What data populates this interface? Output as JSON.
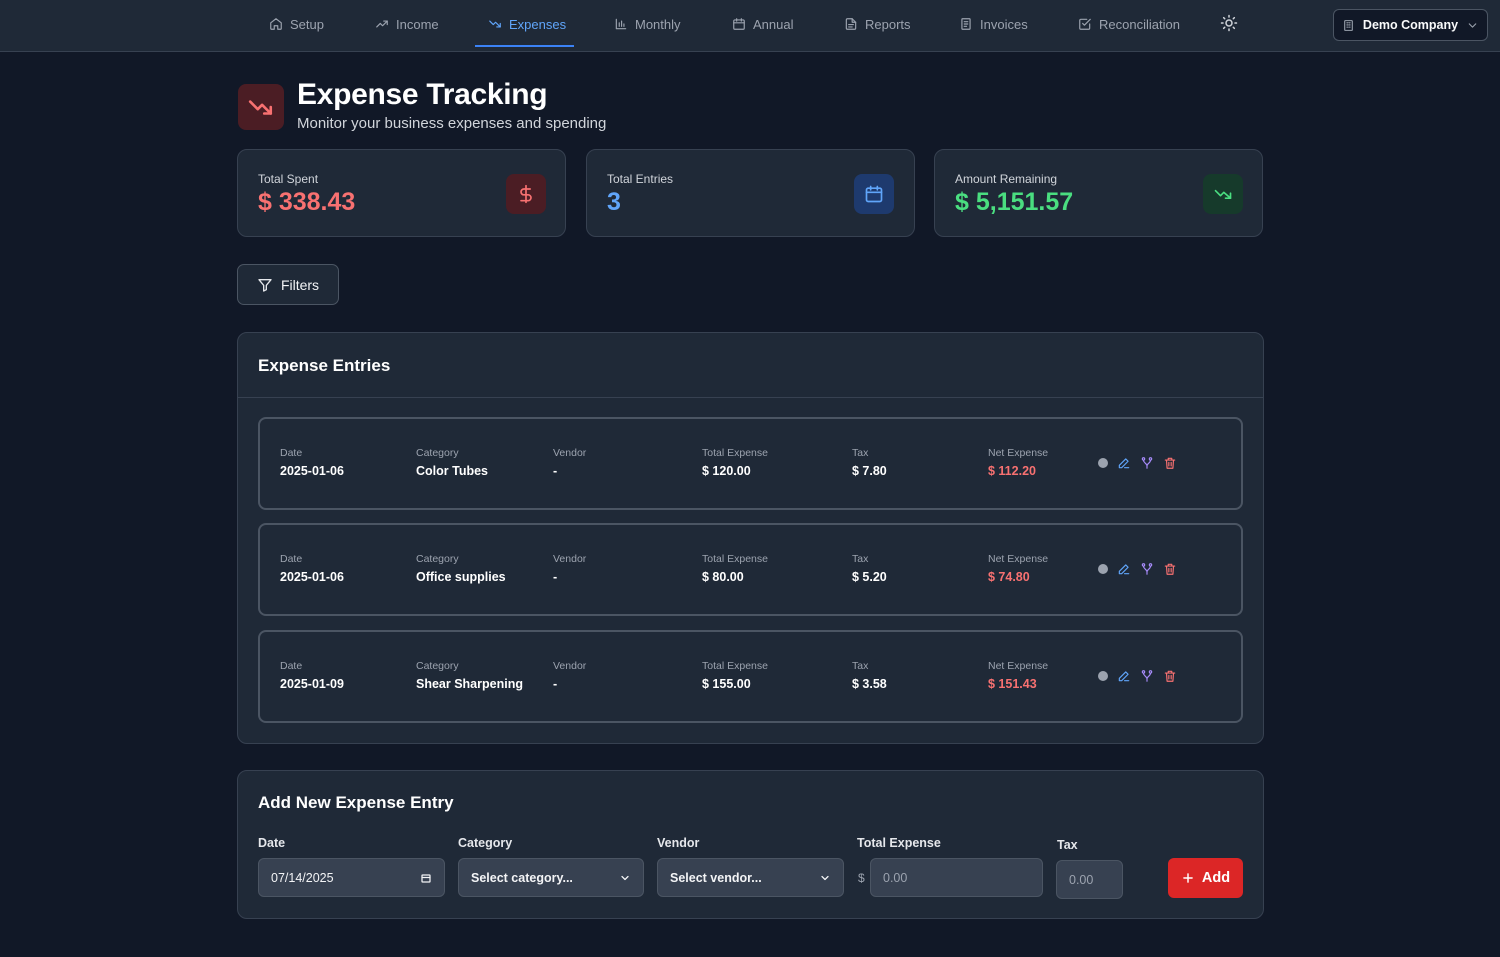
{
  "nav": {
    "items": [
      {
        "label": "Setup",
        "icon": "home-icon"
      },
      {
        "label": "Income",
        "icon": "trending-up-icon"
      },
      {
        "label": "Expenses",
        "icon": "trending-down-icon",
        "active": true
      },
      {
        "label": "Monthly",
        "icon": "bar-chart-icon"
      },
      {
        "label": "Annual",
        "icon": "calendar-icon"
      },
      {
        "label": "Reports",
        "icon": "file-text-icon"
      },
      {
        "label": "Invoices",
        "icon": "receipt-icon"
      },
      {
        "label": "Reconciliation",
        "icon": "check-square-icon"
      }
    ],
    "theme_icon": "sun-icon",
    "company": "Demo Company"
  },
  "header": {
    "title": "Expense Tracking",
    "subtitle": "Monitor your business expenses and spending"
  },
  "stats": {
    "total_spent": {
      "label": "Total Spent",
      "value": "$ 338.43"
    },
    "total_entries": {
      "label": "Total Entries",
      "value": "3"
    },
    "amount_remaining": {
      "label": "Amount Remaining",
      "value": "$ 5,151.57"
    }
  },
  "filters_label": "Filters",
  "entries": {
    "title": "Expense Entries",
    "columns": {
      "date": "Date",
      "category": "Category",
      "vendor": "Vendor",
      "total": "Total Expense",
      "tax": "Tax",
      "net": "Net Expense"
    },
    "rows": [
      {
        "date": "2025-01-06",
        "category": "Color Tubes",
        "vendor": "-",
        "total": "$ 120.00",
        "tax": "$ 7.80",
        "net": "$ 112.20"
      },
      {
        "date": "2025-01-06",
        "category": "Office supplies",
        "vendor": "-",
        "total": "$ 80.00",
        "tax": "$ 5.20",
        "net": "$ 74.80"
      },
      {
        "date": "2025-01-09",
        "category": "Shear Sharpening",
        "vendor": "-",
        "total": "$ 155.00",
        "tax": "$ 3.58",
        "net": "$ 151.43"
      }
    ]
  },
  "add_form": {
    "title": "Add New Expense Entry",
    "date_label": "Date",
    "date_value": "07/14/2025",
    "category_label": "Category",
    "category_value": "Select category...",
    "vendor_label": "Vendor",
    "vendor_value": "Select vendor...",
    "total_label": "Total Expense",
    "currency_sign": "$",
    "total_placeholder": "0.00",
    "tax_label": "Tax",
    "tax_placeholder": "0.00",
    "add_label": "Add"
  },
  "colors": {
    "accent": "#3b82f6",
    "expense_red": "#f87171",
    "positive_green": "#4ade80",
    "entries_blue": "#60a5fa",
    "add_button": "#dc2626"
  }
}
